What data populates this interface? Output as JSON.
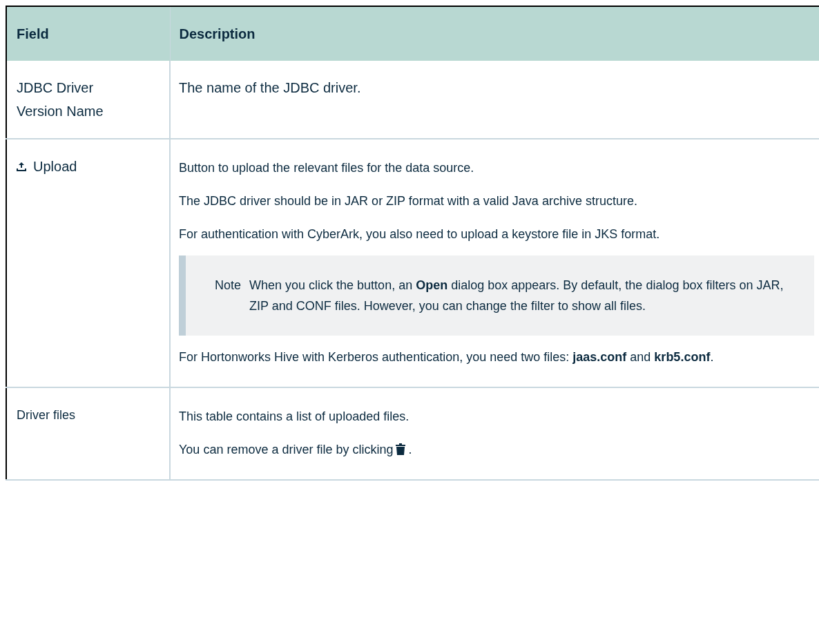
{
  "table": {
    "columns": [
      "Field",
      "Description"
    ],
    "rows": [
      {
        "kind": "title",
        "field": "JDBC Driver Version Name",
        "description": [
          {
            "kind": "text",
            "text": "The name of the JDBC driver."
          }
        ]
      },
      {
        "kind": "upload",
        "field": "Upload",
        "description": [
          {
            "kind": "text",
            "text": "Button to upload the relevant files for the data source."
          },
          {
            "kind": "text",
            "text": "The JDBC driver should be in JAR or ZIP format with a valid Java archive structure."
          },
          {
            "kind": "text",
            "text": "For authentication with CyberArk, you also need to upload a keystore file in JKS format."
          },
          {
            "kind": "note",
            "label": "Note",
            "text": "When you click the button, an **Open** dialog box appears. By default, the dialog box filters on JAR, ZIP and CONF files. However, you can change the filter to show all files."
          },
          {
            "kind": "text",
            "text": "For Hortonworks Hive with Kerberos authentication, you need two files: **jaas.conf** and **krb5.conf**."
          }
        ]
      },
      {
        "kind": "plain",
        "field": "Driver files",
        "description": [
          {
            "kind": "text",
            "text": "This table contains a list of uploaded files."
          },
          {
            "kind": "trash",
            "text": "You can remove a driver file by clicking",
            "after": "."
          }
        ]
      }
    ]
  }
}
